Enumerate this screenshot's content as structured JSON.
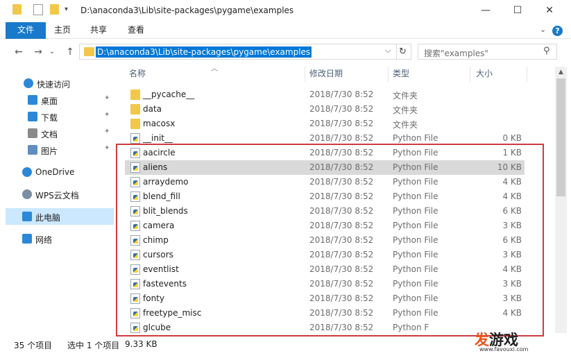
{
  "window": {
    "title": "D:\\anaconda3\\Lib\\site-packages\\pygame\\examples",
    "minimize_glyph": "—",
    "maximize_glyph": "☐",
    "close_glyph": "✕"
  },
  "ribbon": {
    "tabs": [
      {
        "label": "文件"
      },
      {
        "label": "主页"
      },
      {
        "label": "共享"
      },
      {
        "label": "查看"
      }
    ],
    "expand_glyph": "⌄",
    "help_glyph": "?"
  },
  "address": {
    "back_glyph": "←",
    "forward_glyph": "→",
    "recent_glyph": "⌄",
    "up_glyph": "↑",
    "path": "D:\\anaconda3\\Lib\\site-packages\\pygame\\examples",
    "dropdown_glyph": "⌵",
    "refresh_glyph": "↻",
    "search_placeholder": "搜索\"examples\"",
    "search_glyph": "⚲"
  },
  "nav": {
    "pin_glyph": "✦",
    "items": [
      {
        "label": "快速访问",
        "icon": "star-icon",
        "color": "#2b88d8"
      },
      {
        "label": "桌面",
        "icon": "desktop-icon",
        "color": "#2b88d8",
        "pinned": true
      },
      {
        "label": "下载",
        "icon": "download-icon",
        "color": "#2b88d8",
        "pinned": true
      },
      {
        "label": "文档",
        "icon": "document-icon",
        "color": "#8a8a8a",
        "pinned": true
      },
      {
        "label": "图片",
        "icon": "picture-icon",
        "color": "#5f8fbf",
        "pinned": true
      },
      {
        "label": "OneDrive",
        "icon": "cloud-icon",
        "color": "#2b88d8"
      },
      {
        "label": "WPS云文档",
        "icon": "cloud-icon",
        "color": "#7a8ea5"
      },
      {
        "label": "此电脑",
        "icon": "computer-icon",
        "color": "#2b88d8"
      },
      {
        "label": "网络",
        "icon": "network-icon",
        "color": "#2b88d8"
      }
    ]
  },
  "columns": {
    "name": "名称",
    "modified": "修改日期",
    "type": "类型",
    "size": "大小",
    "sort_glyph": "︿"
  },
  "files": [
    {
      "name": "__pycache__",
      "date": "2018/7/30 8:52",
      "type": "文件夹",
      "size": "",
      "kind": "folder"
    },
    {
      "name": "data",
      "date": "2018/7/30 8:52",
      "type": "文件夹",
      "size": "",
      "kind": "folder"
    },
    {
      "name": "macosx",
      "date": "2018/7/30 8:52",
      "type": "文件夹",
      "size": "",
      "kind": "folder"
    },
    {
      "name": "__init__",
      "date": "2018/7/30 8:52",
      "type": "Python File",
      "size": "0 KB",
      "kind": "py"
    },
    {
      "name": "aacircle",
      "date": "2018/7/30 8:52",
      "type": "Python File",
      "size": "1 KB",
      "kind": "py"
    },
    {
      "name": "aliens",
      "date": "2018/7/30 8:52",
      "type": "Python File",
      "size": "10 KB",
      "kind": "py",
      "selected": true
    },
    {
      "name": "arraydemo",
      "date": "2018/7/30 8:52",
      "type": "Python File",
      "size": "4 KB",
      "kind": "py"
    },
    {
      "name": "blend_fill",
      "date": "2018/7/30 8:52",
      "type": "Python File",
      "size": "4 KB",
      "kind": "py"
    },
    {
      "name": "blit_blends",
      "date": "2018/7/30 8:52",
      "type": "Python File",
      "size": "6 KB",
      "kind": "py"
    },
    {
      "name": "camera",
      "date": "2018/7/30 8:52",
      "type": "Python File",
      "size": "3 KB",
      "kind": "py"
    },
    {
      "name": "chimp",
      "date": "2018/7/30 8:52",
      "type": "Python File",
      "size": "6 KB",
      "kind": "py"
    },
    {
      "name": "cursors",
      "date": "2018/7/30 8:52",
      "type": "Python File",
      "size": "3 KB",
      "kind": "py"
    },
    {
      "name": "eventlist",
      "date": "2018/7/30 8:52",
      "type": "Python File",
      "size": "4 KB",
      "kind": "py"
    },
    {
      "name": "fastevents",
      "date": "2018/7/30 8:52",
      "type": "Python File",
      "size": "3 KB",
      "kind": "py"
    },
    {
      "name": "fonty",
      "date": "2018/7/30 8:52",
      "type": "Python File",
      "size": "3 KB",
      "kind": "py"
    },
    {
      "name": "freetype_misc",
      "date": "2018/7/30 8:52",
      "type": "Python File",
      "size": "4 KB",
      "kind": "py"
    },
    {
      "name": "glcube",
      "date": "2018/7/30 8:52",
      "type": "Python F",
      "size": "",
      "kind": "py"
    }
  ],
  "status": {
    "count": "35 个项目",
    "selection": "选中 1 个项目",
    "selection_size": "9.33 KB"
  },
  "watermark": {
    "brand_first": "发",
    "brand_rest": "游戏",
    "url": "www.favouxi.com"
  },
  "colors": {
    "accent": "#1979ca",
    "selection": "#0078d7",
    "highlight_box": "#cf3a3f",
    "folder": "#f3c84a"
  }
}
